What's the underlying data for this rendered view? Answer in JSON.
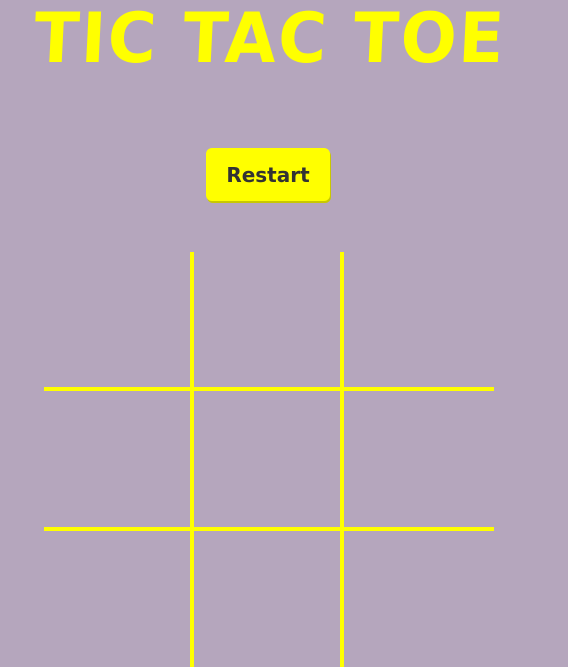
{
  "title": "TIC TAC TOE",
  "restart_label": "Restart",
  "board": {
    "cells": [
      "",
      "",
      "",
      "",
      "",
      "",
      "",
      "",
      ""
    ]
  },
  "colors": {
    "background": "#b5a6bd",
    "accent": "#ffff00",
    "button_text": "#333333"
  }
}
